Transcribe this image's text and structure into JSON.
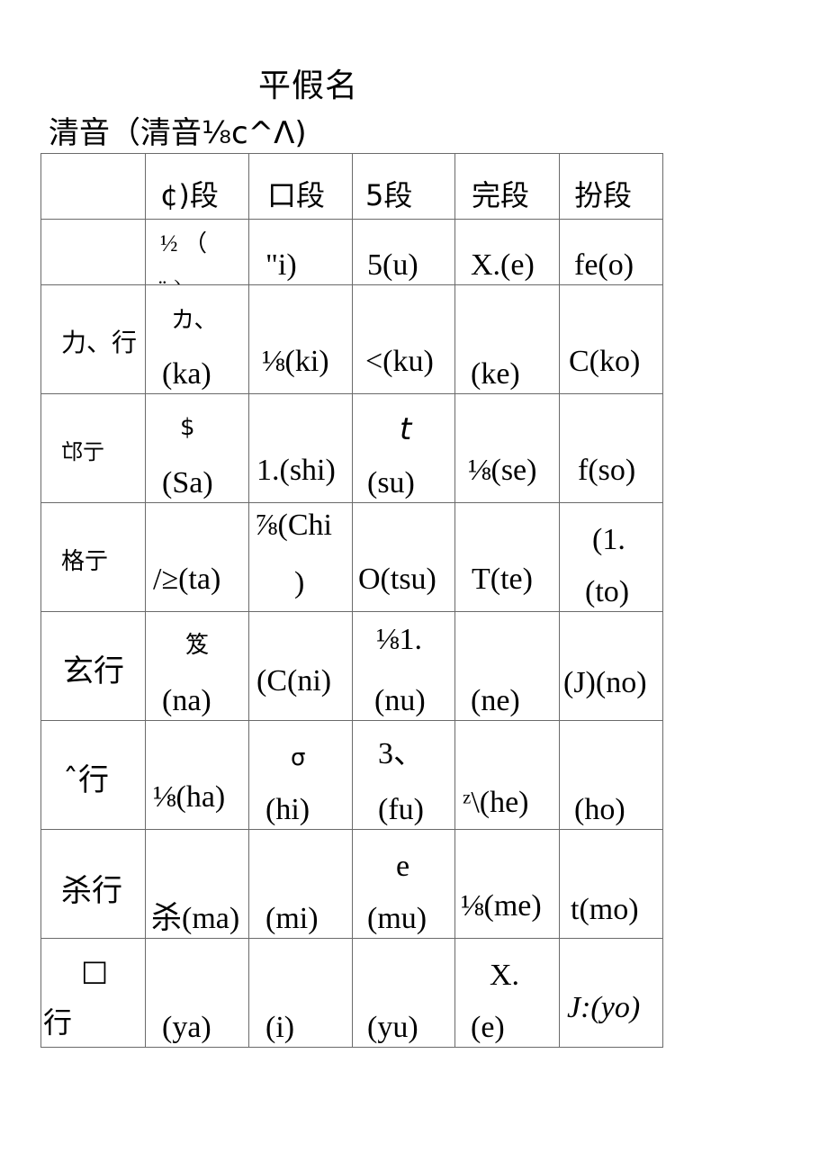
{
  "document": {
    "title": "平假名",
    "subtitle": "清音（清音⅛c^Λ)"
  },
  "table": {
    "header": [
      "",
      "¢)段",
      "口段",
      "5段",
      "完段",
      "扮段"
    ],
    "rows": [
      {
        "label": "",
        "cells": [
          {
            "top": "½ （",
            "bottom": "ü )"
          },
          {
            "top": "",
            "bottom": "\"i)"
          },
          {
            "top": "",
            "bottom": "5(u)"
          },
          {
            "top": "",
            "bottom": "X.(e)"
          },
          {
            "top": "",
            "bottom": "fe(o)"
          }
        ]
      },
      {
        "label": "力、行",
        "cells": [
          {
            "top": "カ、",
            "bottom": "(ka)"
          },
          {
            "top": "",
            "bottom": "⅛(ki)"
          },
          {
            "top": "",
            "bottom": "<(ku)"
          },
          {
            "top": "",
            "bottom": "(ke)"
          },
          {
            "top": "",
            "bottom": "C(ko)"
          }
        ]
      },
      {
        "label": "邙亍",
        "cells": [
          {
            "top": "$",
            "bottom": "(Sa)"
          },
          {
            "top": "",
            "bottom": "1.(shi)"
          },
          {
            "top": "t",
            "bottom": "(su)"
          },
          {
            "top": "",
            "bottom": "⅛(se)"
          },
          {
            "top": "",
            "bottom": "f(so)"
          }
        ]
      },
      {
        "label": "格亍",
        "cells": [
          {
            "top": "",
            "bottom": "/≥(ta)"
          },
          {
            "top": "⅞(Chi",
            "bottom": ")"
          },
          {
            "top": "",
            "bottom": "O(tsu)"
          },
          {
            "top": "",
            "bottom": "T(te)"
          },
          {
            "top": "(1.",
            "bottom": "(to)"
          }
        ]
      },
      {
        "label": "玄行",
        "cells": [
          {
            "top": "笈",
            "bottom": "(na)"
          },
          {
            "top": "",
            "bottom": "(C(ni)"
          },
          {
            "top": "⅛1.",
            "bottom": "(nu)"
          },
          {
            "top": "",
            "bottom": "(ne)"
          },
          {
            "top": "",
            "bottom": "(J)(no)"
          }
        ]
      },
      {
        "label": "ˆ行",
        "cells": [
          {
            "top": "",
            "bottom": "⅛(ha)"
          },
          {
            "top": "σ",
            "bottom": "(hi)"
          },
          {
            "top": "3、",
            "bottom": "(fu)"
          },
          {
            "top": "",
            "bottom": "ᶻ\\(he)"
          },
          {
            "top": "",
            "bottom": "(ho)"
          }
        ]
      },
      {
        "label": "杀行",
        "cells": [
          {
            "top": "",
            "bottom": "杀(ma)"
          },
          {
            "top": "",
            "bottom": "(mi)"
          },
          {
            "top": "e",
            "bottom": "(mu)"
          },
          {
            "top": "",
            "bottom": "⅛(me)"
          },
          {
            "top": "",
            "bottom": "t(mo)"
          }
        ]
      },
      {
        "label_top": "□",
        "label": "行",
        "cells": [
          {
            "top": "",
            "bottom": "(ya)"
          },
          {
            "top": "",
            "bottom": "(i)"
          },
          {
            "top": "",
            "bottom": "(yu)"
          },
          {
            "top": "X.",
            "bottom": "(e)"
          },
          {
            "top": "",
            "bottom": "J:(yo)"
          }
        ]
      }
    ]
  }
}
